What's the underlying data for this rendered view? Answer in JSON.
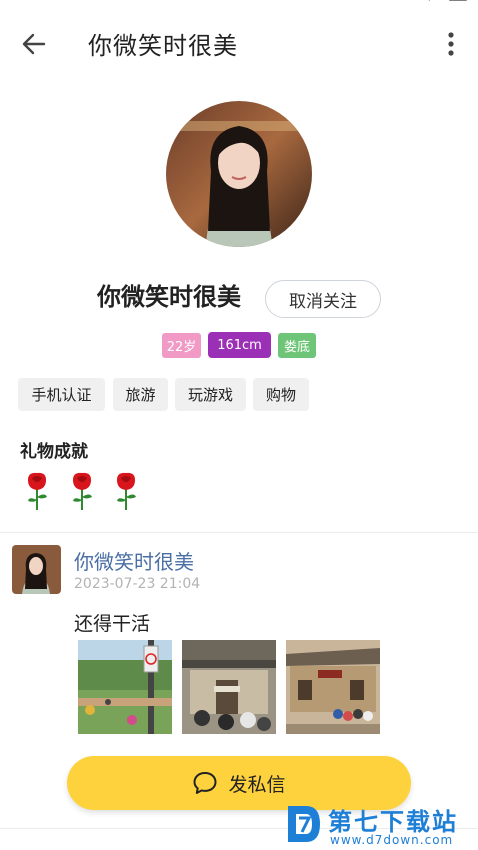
{
  "header": {
    "title": "你微笑时很美",
    "back_icon": "arrow-left-icon",
    "more_icon": "more-vertical-icon"
  },
  "profile": {
    "name": "你微笑时很美",
    "follow_label": "取消关注",
    "badges": [
      {
        "label": "22岁",
        "color": "#f19ac6"
      },
      {
        "label": "161cm",
        "color": "#9b2fb6"
      },
      {
        "label": "娄底",
        "color": "#6fc577"
      }
    ],
    "tags": [
      "手机认证",
      "旅游",
      "玩游戏",
      "购物"
    ]
  },
  "gifts": {
    "title": "礼物成就",
    "count": 3,
    "icon": "rose-icon"
  },
  "post": {
    "author": "你微笑时很美",
    "time": "2023-07-23 21:04",
    "text": "还得干活",
    "photos": [
      "park-photo",
      "village-gate-photo",
      "old-house-photo"
    ]
  },
  "actions": {
    "message_label": "发私信",
    "message_icon": "chat-bubble-icon"
  },
  "watermark": {
    "text": "第七下载站",
    "url": "www.d7down.com"
  },
  "colors": {
    "accent_yellow": "#fdd23d",
    "author_blue": "#4a6fa5",
    "watermark_blue": "#1e7fd6"
  }
}
